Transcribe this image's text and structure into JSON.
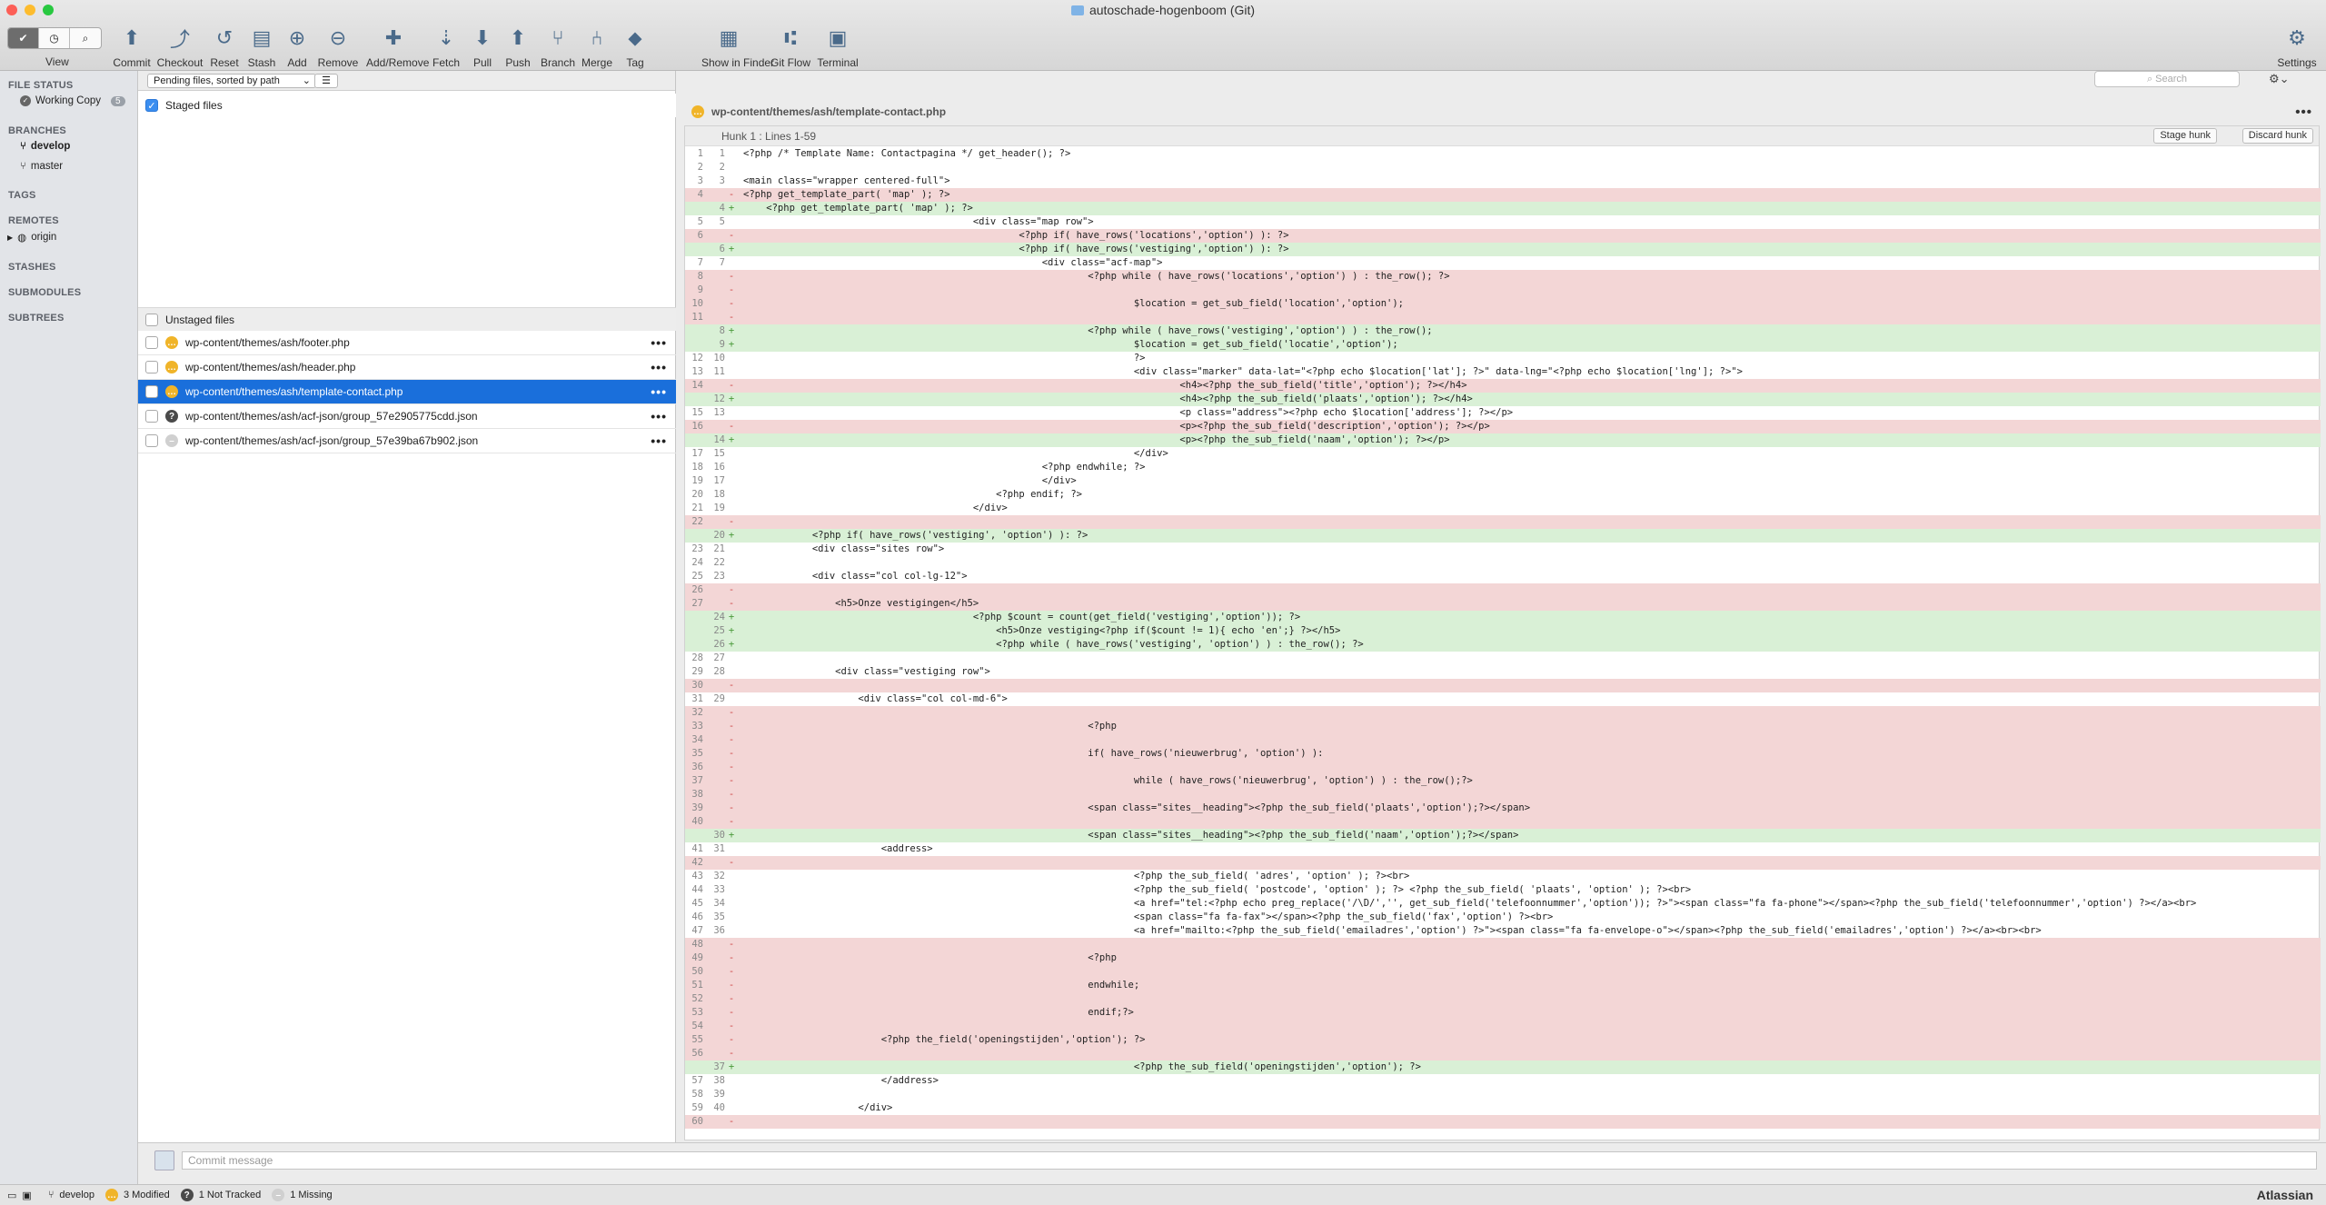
{
  "window": {
    "title": "autoschade-hogenboom (Git)"
  },
  "toolbar": {
    "view_label": "View",
    "items": [
      {
        "label": "Commit"
      },
      {
        "label": "Checkout"
      },
      {
        "label": "Reset"
      },
      {
        "label": "Stash"
      },
      {
        "label": "Add"
      },
      {
        "label": "Remove"
      },
      {
        "label": "Add/Remove"
      },
      {
        "label": "Fetch"
      },
      {
        "label": "Pull"
      },
      {
        "label": "Push"
      },
      {
        "label": "Branch"
      },
      {
        "label": "Merge"
      },
      {
        "label": "Tag"
      },
      {
        "label": "Show in Finder"
      },
      {
        "label": "Git Flow"
      },
      {
        "label": "Terminal"
      },
      {
        "label": "Settings"
      }
    ]
  },
  "sidebar": {
    "file_status": "FILE STATUS",
    "working_copy": "Working Copy",
    "working_copy_count": "5",
    "branches": "BRANCHES",
    "branch_items": [
      "develop",
      "master"
    ],
    "tags": "TAGS",
    "remotes": "REMOTES",
    "remote_items": [
      "origin"
    ],
    "stashes": "STASHES",
    "submodules": "SUBMODULES",
    "subtrees": "SUBTREES"
  },
  "files": {
    "sort": "Pending files, sorted by path",
    "staged_label": "Staged files",
    "unstaged_label": "Unstaged files",
    "items": [
      {
        "path": "wp-content/themes/ash/footer.php",
        "status": "mod",
        "icon": "modified-icon"
      },
      {
        "path": "wp-content/themes/ash/header.php",
        "status": "mod",
        "icon": "modified-icon"
      },
      {
        "path": "wp-content/themes/ash/template-contact.php",
        "status": "mod",
        "icon": "modified-icon"
      },
      {
        "path": "wp-content/themes/ash/acf-json/group_57e2905775cdd.json",
        "status": "unk",
        "icon": "untracked-icon"
      },
      {
        "path": "wp-content/themes/ash/acf-json/group_57e39ba67b902.json",
        "status": "mis",
        "icon": "missing-icon"
      }
    ]
  },
  "search": {
    "placeholder": "Search"
  },
  "diff": {
    "file": "wp-content/themes/ash/template-contact.php",
    "hunk_title": "Hunk 1 : Lines 1-59",
    "stage_hunk": "Stage hunk",
    "discard_hunk": "Discard hunk",
    "lines": [
      {
        "o": "1",
        "n": "1",
        "t": "ctx",
        "c": "<?php /* Template Name: Contactpagina */ get_header(); ?>"
      },
      {
        "o": "2",
        "n": "2",
        "t": "ctx",
        "c": ""
      },
      {
        "o": "3",
        "n": "3",
        "t": "ctx",
        "c": "<main class=\"wrapper centered-full\">"
      },
      {
        "o": "4",
        "n": "",
        "t": "del",
        "c": "<?php get_template_part( 'map' ); ?>"
      },
      {
        "o": "",
        "n": "4",
        "t": "add",
        "c": "    <?php get_template_part( 'map' ); ?>"
      },
      {
        "o": "5",
        "n": "5",
        "t": "ctx",
        "c": "                                        <div class=\"map row\">"
      },
      {
        "o": "6",
        "n": "",
        "t": "del",
        "c": "                                                <?php if( have_rows('locations','option') ): ?>"
      },
      {
        "o": "",
        "n": "6",
        "t": "add",
        "c": "                                                <?php if( have_rows('vestiging','option') ): ?>"
      },
      {
        "o": "7",
        "n": "7",
        "t": "ctx",
        "c": "                                                    <div class=\"acf-map\">"
      },
      {
        "o": "8",
        "n": "",
        "t": "del",
        "c": "                                                            <?php while ( have_rows('locations','option') ) : the_row(); ?>"
      },
      {
        "o": "9",
        "n": "",
        "t": "del",
        "c": ""
      },
      {
        "o": "10",
        "n": "",
        "t": "del",
        "c": "                                                                    $location = get_sub_field('location','option');"
      },
      {
        "o": "11",
        "n": "",
        "t": "del",
        "c": ""
      },
      {
        "o": "",
        "n": "8",
        "t": "add",
        "c": "                                                            <?php while ( have_rows('vestiging','option') ) : the_row();"
      },
      {
        "o": "",
        "n": "9",
        "t": "add",
        "c": "                                                                    $location = get_sub_field('locatie','option');"
      },
      {
        "o": "12",
        "n": "10",
        "t": "ctx",
        "c": "                                                                    ?>"
      },
      {
        "o": "13",
        "n": "11",
        "t": "ctx",
        "c": "                                                                    <div class=\"marker\" data-lat=\"<?php echo $location['lat']; ?>\" data-lng=\"<?php echo $location['lng']; ?>\">"
      },
      {
        "o": "14",
        "n": "",
        "t": "del",
        "c": "                                                                            <h4><?php the_sub_field('title','option'); ?></h4>"
      },
      {
        "o": "",
        "n": "12",
        "t": "add",
        "c": "                                                                            <h4><?php the_sub_field('plaats','option'); ?></h4>"
      },
      {
        "o": "15",
        "n": "13",
        "t": "ctx",
        "c": "                                                                            <p class=\"address\"><?php echo $location['address']; ?></p>"
      },
      {
        "o": "16",
        "n": "",
        "t": "del",
        "c": "                                                                            <p><?php the_sub_field('description','option'); ?></p>"
      },
      {
        "o": "",
        "n": "14",
        "t": "add",
        "c": "                                                                            <p><?php the_sub_field('naam','option'); ?></p>"
      },
      {
        "o": "17",
        "n": "15",
        "t": "ctx",
        "c": "                                                                    </div>"
      },
      {
        "o": "18",
        "n": "16",
        "t": "ctx",
        "c": "                                                    <?php endwhile; ?>"
      },
      {
        "o": "19",
        "n": "17",
        "t": "ctx",
        "c": "                                                    </div>"
      },
      {
        "o": "20",
        "n": "18",
        "t": "ctx",
        "c": "                                            <?php endif; ?>"
      },
      {
        "o": "21",
        "n": "19",
        "t": "ctx",
        "c": "                                        </div>"
      },
      {
        "o": "22",
        "n": "",
        "t": "del",
        "c": ""
      },
      {
        "o": "",
        "n": "20",
        "t": "add",
        "c": "            <?php if( have_rows('vestiging', 'option') ): ?>"
      },
      {
        "o": "23",
        "n": "21",
        "t": "ctx",
        "c": "            <div class=\"sites row\">"
      },
      {
        "o": "24",
        "n": "22",
        "t": "ctx",
        "c": ""
      },
      {
        "o": "25",
        "n": "23",
        "t": "ctx",
        "c": "            <div class=\"col col-lg-12\">"
      },
      {
        "o": "26",
        "n": "",
        "t": "del",
        "c": ""
      },
      {
        "o": "27",
        "n": "",
        "t": "del",
        "c": "                <h5>Onze vestigingen</h5>"
      },
      {
        "o": "",
        "n": "24",
        "t": "add",
        "c": "                                        <?php $count = count(get_field('vestiging','option')); ?>"
      },
      {
        "o": "",
        "n": "25",
        "t": "add",
        "c": "                                            <h5>Onze vestiging<?php if($count != 1){ echo 'en';} ?></h5>"
      },
      {
        "o": "",
        "n": "26",
        "t": "add",
        "c": "                                            <?php while ( have_rows('vestiging', 'option') ) : the_row(); ?>"
      },
      {
        "o": "28",
        "n": "27",
        "t": "ctx",
        "c": ""
      },
      {
        "o": "29",
        "n": "28",
        "t": "ctx",
        "c": "                <div class=\"vestiging row\">"
      },
      {
        "o": "30",
        "n": "",
        "t": "del",
        "c": ""
      },
      {
        "o": "31",
        "n": "29",
        "t": "ctx",
        "c": "                    <div class=\"col col-md-6\">"
      },
      {
        "o": "32",
        "n": "",
        "t": "del",
        "c": ""
      },
      {
        "o": "33",
        "n": "",
        "t": "del",
        "c": "                                                            <?php"
      },
      {
        "o": "34",
        "n": "",
        "t": "del",
        "c": ""
      },
      {
        "o": "35",
        "n": "",
        "t": "del",
        "c": "                                                            if( have_rows('nieuwerbrug', 'option') ):"
      },
      {
        "o": "36",
        "n": "",
        "t": "del",
        "c": ""
      },
      {
        "o": "37",
        "n": "",
        "t": "del",
        "c": "                                                                    while ( have_rows('nieuwerbrug', 'option') ) : the_row();?>"
      },
      {
        "o": "38",
        "n": "",
        "t": "del",
        "c": ""
      },
      {
        "o": "39",
        "n": "",
        "t": "del",
        "c": "                                                            <span class=\"sites__heading\"><?php the_sub_field('plaats','option');?></span>"
      },
      {
        "o": "40",
        "n": "",
        "t": "del",
        "c": ""
      },
      {
        "o": "",
        "n": "30",
        "t": "add",
        "c": "                                                            <span class=\"sites__heading\"><?php the_sub_field('naam','option');?></span>"
      },
      {
        "o": "41",
        "n": "31",
        "t": "ctx",
        "c": "                        <address>"
      },
      {
        "o": "42",
        "n": "",
        "t": "del",
        "c": ""
      },
      {
        "o": "43",
        "n": "32",
        "t": "ctx",
        "c": "                                                                    <?php the_sub_field( 'adres', 'option' ); ?><br>"
      },
      {
        "o": "44",
        "n": "33",
        "t": "ctx",
        "c": "                                                                    <?php the_sub_field( 'postcode', 'option' ); ?> <?php the_sub_field( 'plaats', 'option' ); ?><br>"
      },
      {
        "o": "45",
        "n": "34",
        "t": "ctx",
        "c": "                                                                    <a href=\"tel:<?php echo preg_replace('/\\D/','', get_sub_field('telefoonnummer','option')); ?>\"><span class=\"fa fa-phone\"></span><?php the_sub_field('telefoonnummer','option') ?></a><br>"
      },
      {
        "o": "46",
        "n": "35",
        "t": "ctx",
        "c": "                                                                    <span class=\"fa fa-fax\"></span><?php the_sub_field('fax','option') ?><br>"
      },
      {
        "o": "47",
        "n": "36",
        "t": "ctx",
        "c": "                                                                    <a href=\"mailto:<?php the_sub_field('emailadres','option') ?>\"><span class=\"fa fa-envelope-o\"></span><?php the_sub_field('emailadres','option') ?></a><br><br>"
      },
      {
        "o": "48",
        "n": "",
        "t": "del",
        "c": ""
      },
      {
        "o": "49",
        "n": "",
        "t": "del",
        "c": "                                                            <?php"
      },
      {
        "o": "50",
        "n": "",
        "t": "del",
        "c": ""
      },
      {
        "o": "51",
        "n": "",
        "t": "del",
        "c": "                                                            endwhile;"
      },
      {
        "o": "52",
        "n": "",
        "t": "del",
        "c": ""
      },
      {
        "o": "53",
        "n": "",
        "t": "del",
        "c": "                                                            endif;?>"
      },
      {
        "o": "54",
        "n": "",
        "t": "del",
        "c": ""
      },
      {
        "o": "55",
        "n": "",
        "t": "del",
        "c": "                        <?php the_field('openingstijden','option'); ?>"
      },
      {
        "o": "56",
        "n": "",
        "t": "del",
        "c": ""
      },
      {
        "o": "",
        "n": "37",
        "t": "add",
        "c": "                                                                    <?php the_sub_field('openingstijden','option'); ?>"
      },
      {
        "o": "57",
        "n": "38",
        "t": "ctx",
        "c": "                        </address>"
      },
      {
        "o": "58",
        "n": "39",
        "t": "ctx",
        "c": ""
      },
      {
        "o": "59",
        "n": "40",
        "t": "ctx",
        "c": "                    </div>"
      },
      {
        "o": "60",
        "n": "",
        "t": "del",
        "c": ""
      }
    ]
  },
  "commit": {
    "placeholder": "Commit message"
  },
  "status": {
    "branch": "develop",
    "modified": "3 Modified",
    "not_tracked": "1 Not Tracked",
    "missing": "1 Missing",
    "brand": "Atlassian"
  }
}
